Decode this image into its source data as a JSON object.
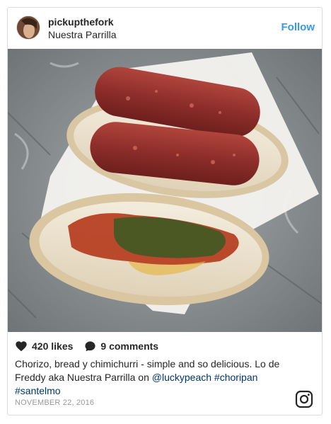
{
  "post": {
    "username": "pickupthefork",
    "location": "Nuestra Parrilla",
    "follow_label": "Follow",
    "likes": "420 likes",
    "comments": "9 comments",
    "caption_text": "Chorizo, bread y chimichurri - simple and so delicious. Lo de Freddy aka Nuestra Parrilla on ",
    "mention": "@luckypeach",
    "hashtag_1": "#choripan",
    "hashtag_2": "#santelmo",
    "date": "NOVEMBER 22, 2016"
  },
  "icons": {
    "like": "heart-icon",
    "comment": "comment-icon",
    "brand": "instagram-icon"
  },
  "colors": {
    "link": "#003569",
    "follow": "#3897f0",
    "date": "#999999"
  }
}
